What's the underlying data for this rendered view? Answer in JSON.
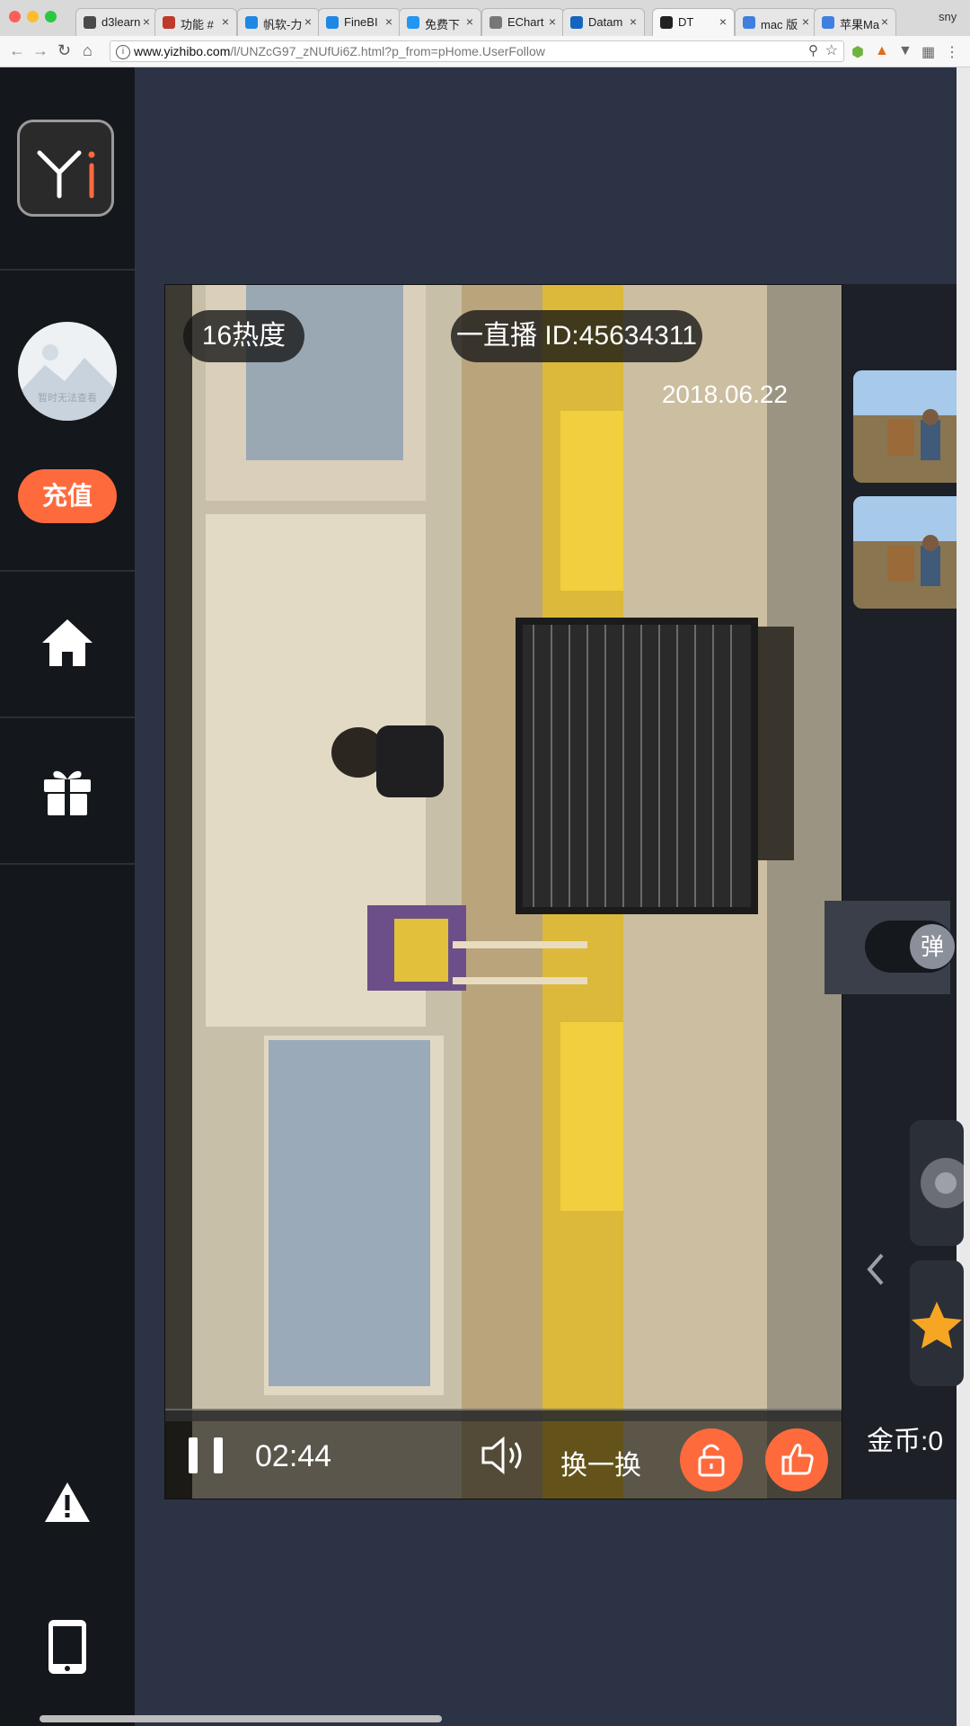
{
  "browser": {
    "tabs": [
      {
        "label": "d3learn",
        "favicon_color": "#4a4a4a"
      },
      {
        "label": "功能 #",
        "favicon_color": "#c0392b"
      },
      {
        "label": "帆软-力",
        "favicon_color": "#1e88e5"
      },
      {
        "label": "FineBI",
        "favicon_color": "#1e88e5"
      },
      {
        "label": "免费下",
        "favicon_color": "#2196f3"
      },
      {
        "label": "EChart",
        "favicon_color": "#777777"
      },
      {
        "label": "Datam",
        "favicon_color": "#1565c0"
      },
      {
        "label": "DT",
        "favicon_color": "#222222"
      },
      {
        "label": "mac 版",
        "favicon_color": "#3f7fe0"
      },
      {
        "label": "苹果Ma",
        "favicon_color": "#3f7fe0"
      }
    ],
    "profile_label": "sny",
    "url_host": "www.yizhibo.com",
    "url_path": "/l/UNZcG97_zNUfUi6Z.html?p_from=pHome.UserFollow"
  },
  "nav": {
    "avatar_text": "暂时无法查看",
    "recharge_label": "充值",
    "icons": [
      "logo-icon",
      "home-icon",
      "gift-icon",
      "warning-icon",
      "phone-icon"
    ]
  },
  "player": {
    "heat_label": "16热度",
    "channel_label": "一直播 ID:45634311",
    "date": "2018.06.22",
    "time": "02:44",
    "swap_label": "换一换"
  },
  "side": {
    "danmu_label": "弹",
    "coins_label": "金币:0"
  },
  "colors": {
    "accent": "#ff6a3d",
    "nav_bg": "#14171c",
    "page_bg": "#2c3345"
  }
}
